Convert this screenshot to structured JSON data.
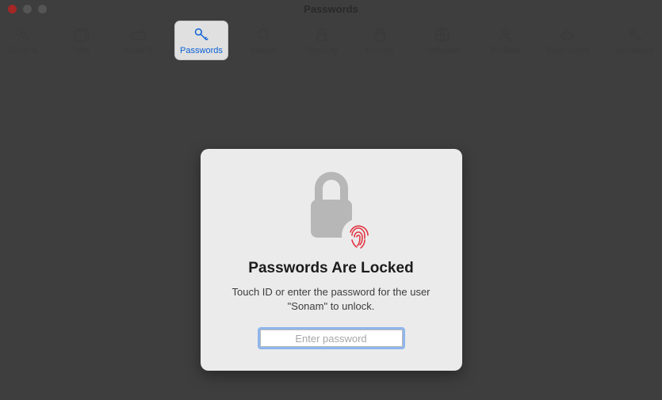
{
  "window": {
    "title": "Passwords"
  },
  "tabs": [
    {
      "id": "general",
      "label": "General",
      "icon": "gear-icon"
    },
    {
      "id": "tabs",
      "label": "Tabs",
      "icon": "tabs-icon"
    },
    {
      "id": "autofill",
      "label": "AutoFill",
      "icon": "autofill-icon"
    },
    {
      "id": "passwords",
      "label": "Passwords",
      "icon": "key-icon",
      "active": true
    },
    {
      "id": "search",
      "label": "Search",
      "icon": "search-icon"
    },
    {
      "id": "security",
      "label": "Security",
      "icon": "lock-icon"
    },
    {
      "id": "privacy",
      "label": "Privacy",
      "icon": "hand-icon"
    },
    {
      "id": "websites",
      "label": "Websites",
      "icon": "globe-icon"
    },
    {
      "id": "profiles",
      "label": "Profiles",
      "icon": "person-icon"
    },
    {
      "id": "extensions",
      "label": "Extensions",
      "icon": "puzzle-icon"
    },
    {
      "id": "advanced",
      "label": "Advanced",
      "icon": "gears-icon"
    }
  ],
  "locked": {
    "heading": "Passwords Are Locked",
    "description": "Touch ID or enter the password for the user \"Sonam\" to unlock.",
    "placeholder": "Enter password"
  }
}
